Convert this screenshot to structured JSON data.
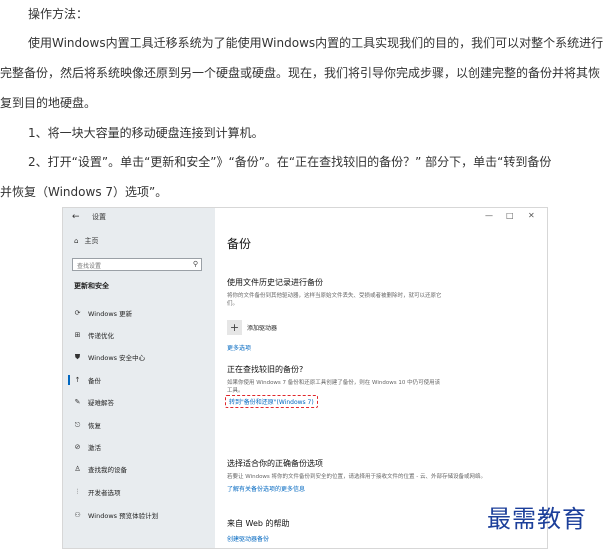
{
  "article": {
    "heading": "操作方法：",
    "para1_lines": [
      "使用Windows内置工具迁移系统为了能使用Windows内置的工具实现我们的目的，我们可以对整个系统进行",
      "完整备份，然后将系统映像还原到另一个硬盘或硬盘。现在，我们将引导你完成步骤，以创建完整的备份并将其恢",
      "复到目的地硬盘。"
    ],
    "step1": "1、将一块大容量的移动硬盘连接到计算机。",
    "step2_lines": [
      "2、打开“设置”。单击“更新和安全”》“备份”。在“正在查找较旧的备份？” 部分下，单击“转到备份",
      "并恢复（Windows 7）选项”。"
    ]
  },
  "settings": {
    "titlebar": {
      "back_glyph": "←",
      "title": "设置"
    },
    "window_controls": [
      "—",
      "□",
      "✕"
    ],
    "sidebar": {
      "home": "主页",
      "search_placeholder": "查找设置",
      "section": "更新和安全",
      "items": [
        {
          "icon": "refresh-icon",
          "glyph": "⟳",
          "label": "Windows 更新"
        },
        {
          "icon": "delivery-optimization-icon",
          "glyph": "⊞",
          "label": "传递优化"
        },
        {
          "icon": "shield-icon",
          "glyph": "⛊",
          "label": "Windows 安全中心"
        },
        {
          "icon": "backup-icon",
          "glyph": "↑",
          "label": "备份"
        },
        {
          "icon": "wrench-icon",
          "glyph": "✎",
          "label": "疑难解答"
        },
        {
          "icon": "recovery-icon",
          "glyph": "⎋",
          "label": "恢复"
        },
        {
          "icon": "activation-icon",
          "glyph": "⊘",
          "label": "激活"
        },
        {
          "icon": "find-device-icon",
          "glyph": "♙",
          "label": "查找我的设备"
        },
        {
          "icon": "developer-icon",
          "glyph": "⫶",
          "label": "开发者选项"
        },
        {
          "icon": "insider-icon",
          "glyph": "⚇",
          "label": "Windows 预览体验计划"
        }
      ]
    },
    "main": {
      "title": "备份",
      "file_history_heading": "使用文件历史记录进行备份",
      "file_history_desc": "将你的文件备份到其他驱动器，这样当原始文件丢失、受损或者被删除时，就可以还原它们。",
      "add_drive": "添加驱动器",
      "more_options": "更多选项",
      "older_backup_heading": "正在查找较旧的备份?",
      "older_backup_desc": "如果你使用 Windows 7 备份和还原工具创建了备份，则在 Windows 10 中仍可使用该工具。",
      "goto_link": "转到\"备份和还原\"(Windows 7)",
      "choose_heading": "选择适合你的正确备份选项",
      "choose_desc": "若要让 Windows 将你的文件备份到安全的位置，请选择用于接收文件的位置 - 云、外部存储设备或网络。",
      "choose_link": "了解有关备份选项的更多信息",
      "web_help_heading": "来自 Web 的帮助",
      "web_help_link": "创建驱动器备份"
    }
  },
  "watermark": "最需教育"
}
